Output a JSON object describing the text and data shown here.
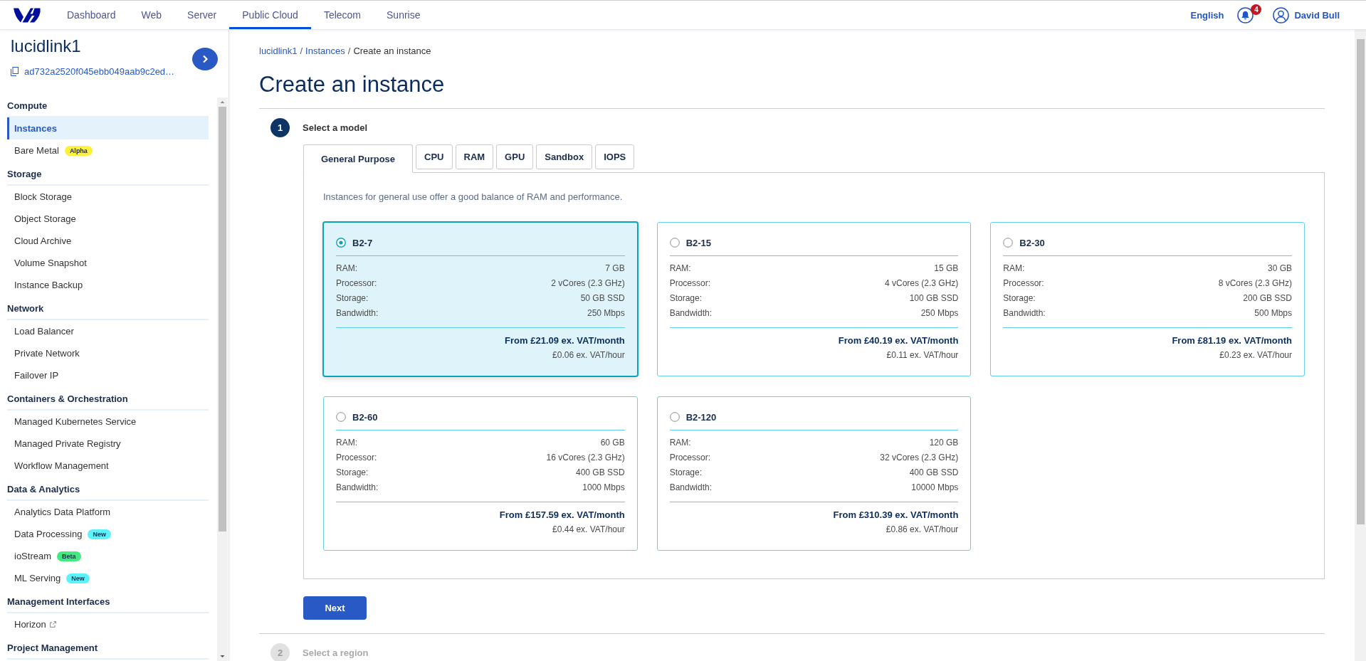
{
  "top_nav": {
    "items": [
      {
        "label": "Dashboard",
        "selected": false
      },
      {
        "label": "Web",
        "selected": false
      },
      {
        "label": "Server",
        "selected": false
      },
      {
        "label": "Public Cloud",
        "selected": true
      },
      {
        "label": "Telecom",
        "selected": false
      },
      {
        "label": "Sunrise",
        "selected": false
      }
    ],
    "language": "English",
    "notification_count": "4",
    "user_name": "David Bull"
  },
  "sidebar": {
    "project_name": "lucidlink1",
    "project_id": "ad732a2520f045ebb049aab9c2ed…",
    "sections": [
      {
        "title": "Compute",
        "items": [
          {
            "label": "Instances",
            "selected": true
          },
          {
            "label": "Bare Metal",
            "selected": false,
            "badge": {
              "text": "Alpha",
              "color": "#fff03c"
            }
          }
        ]
      },
      {
        "title": "Storage",
        "items": [
          {
            "label": "Block Storage",
            "selected": false
          },
          {
            "label": "Object Storage",
            "selected": false
          },
          {
            "label": "Cloud Archive",
            "selected": false
          },
          {
            "label": "Volume Snapshot",
            "selected": false
          },
          {
            "label": "Instance Backup",
            "selected": false
          }
        ]
      },
      {
        "title": "Network",
        "items": [
          {
            "label": "Load Balancer",
            "selected": false
          },
          {
            "label": "Private Network",
            "selected": false
          },
          {
            "label": "Failover IP",
            "selected": false
          }
        ]
      },
      {
        "title": "Containers & Orchestration",
        "items": [
          {
            "label": "Managed Kubernetes Service",
            "selected": false
          },
          {
            "label": "Managed Private Registry",
            "selected": false
          },
          {
            "label": "Workflow Management",
            "selected": false
          }
        ]
      },
      {
        "title": "Data & Analytics",
        "items": [
          {
            "label": "Analytics Data Platform",
            "selected": false
          },
          {
            "label": "Data Processing",
            "selected": false,
            "badge": {
              "text": "New",
              "color": "#5cf2fb"
            }
          },
          {
            "label": "ioStream",
            "selected": false,
            "badge": {
              "text": "Beta",
              "color": "#42ea7e"
            }
          },
          {
            "label": "ML Serving",
            "selected": false,
            "badge": {
              "text": "New",
              "color": "#5cf2fb"
            }
          }
        ]
      },
      {
        "title": "Management Interfaces",
        "items": [
          {
            "label": "Horizon",
            "selected": false,
            "external": true
          }
        ]
      },
      {
        "title": "Project Management"
      }
    ]
  },
  "breadcrumb": [
    {
      "label": "lucidlink1",
      "kind": "link",
      "separator": "/"
    },
    {
      "label": "Instances",
      "kind": "link",
      "separator": "/"
    },
    {
      "label": "Create an instance",
      "kind": "current"
    }
  ],
  "title": "Create an instance",
  "steps": [
    {
      "number": "1",
      "label": "Select a model",
      "active": true,
      "tabs": [
        {
          "label": "General Purpose",
          "selected": true
        },
        {
          "label": "CPU",
          "selected": false
        },
        {
          "label": "RAM",
          "selected": false
        },
        {
          "label": "GPU",
          "selected": false
        },
        {
          "label": "Sandbox",
          "selected": false
        },
        {
          "label": "IOPS",
          "selected": false
        }
      ],
      "description": "Instances for general use offer a good balance of RAM and performance.",
      "models": [
        {
          "name": "B2-7",
          "selected": true,
          "specs": [
            {
              "label": "RAM:",
              "value": "7 GB"
            },
            {
              "label": "Processor:",
              "value": "2 vCores (2.3 GHz)"
            },
            {
              "label": "Storage:",
              "value": "50 GB SSD"
            },
            {
              "label": "Bandwidth:",
              "value": "250 Mbps"
            }
          ],
          "price_month": "From £21.09 ex. VAT/month",
          "price_hour": "£0.06 ex. VAT/hour"
        },
        {
          "name": "B2-15",
          "selected": false,
          "specs": [
            {
              "label": "RAM:",
              "value": "15 GB"
            },
            {
              "label": "Processor:",
              "value": "4 vCores (2.3 GHz)"
            },
            {
              "label": "Storage:",
              "value": "100 GB SSD"
            },
            {
              "label": "Bandwidth:",
              "value": "250 Mbps"
            }
          ],
          "price_month": "From £40.19 ex. VAT/month",
          "price_hour": "£0.11 ex. VAT/hour"
        },
        {
          "name": "B2-30",
          "selected": false,
          "specs": [
            {
              "label": "RAM:",
              "value": "30 GB"
            },
            {
              "label": "Processor:",
              "value": "8 vCores (2.3 GHz)"
            },
            {
              "label": "Storage:",
              "value": "200 GB SSD"
            },
            {
              "label": "Bandwidth:",
              "value": "500 Mbps"
            }
          ],
          "price_month": "From £81.19 ex. VAT/month",
          "price_hour": "£0.23 ex. VAT/hour"
        },
        {
          "name": "B2-60",
          "selected": false,
          "specs": [
            {
              "label": "RAM:",
              "value": "60 GB"
            },
            {
              "label": "Processor:",
              "value": "16 vCores (2.3 GHz)"
            },
            {
              "label": "Storage:",
              "value": "400 GB SSD"
            },
            {
              "label": "Bandwidth:",
              "value": "1000 Mbps"
            }
          ],
          "price_month": "From £157.59 ex. VAT/month",
          "price_hour": "£0.44 ex. VAT/hour"
        },
        {
          "name": "B2-120",
          "selected": false,
          "specs": [
            {
              "label": "RAM:",
              "value": "120 GB"
            },
            {
              "label": "Processor:",
              "value": "32 vCores (2.3 GHz)"
            },
            {
              "label": "Storage:",
              "value": "400 GB SSD"
            },
            {
              "label": "Bandwidth:",
              "value": "10000 Mbps"
            }
          ],
          "price_month": "From £310.39 ex. VAT/month",
          "price_hour": "£0.86 ex. VAT/hour"
        }
      ],
      "next_button": "Next"
    },
    {
      "number": "2",
      "label": "Select a region",
      "active": false
    }
  ]
}
